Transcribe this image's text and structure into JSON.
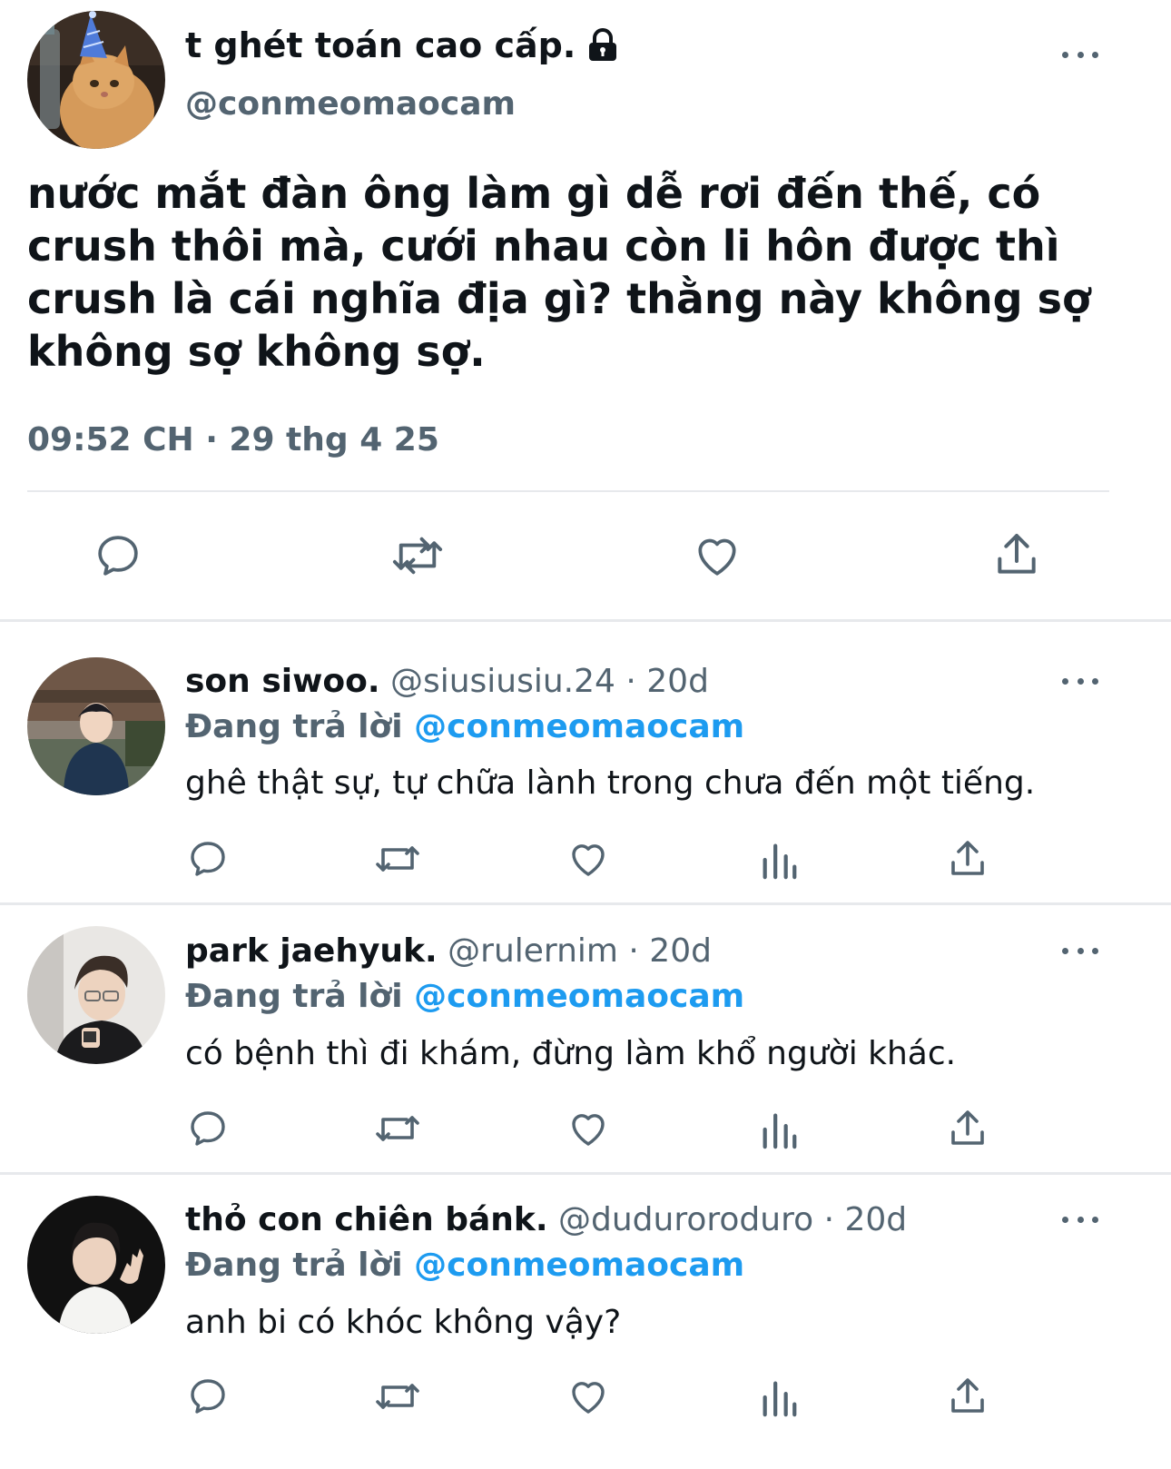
{
  "main_tweet": {
    "display_name": "t ghét toán cao cấp.",
    "handle": "@conmeomaocam",
    "text": "nước mắt đàn ông làm gì dễ rơi đến thế, có crush thôi mà, cưới nhau còn li hôn được thì crush là cái nghĩa địa gì? thằng này không sợ không sợ không sợ.",
    "timestamp": "09:52 CH · 29 thg 4 25",
    "icons": [
      "lock-icon",
      "more-icon",
      "reply-icon",
      "retweet-icon",
      "like-icon",
      "share-icon"
    ]
  },
  "replies": [
    {
      "display_name": "son siwoo.",
      "handle": "@siusiusiu.24",
      "time": "· 20d",
      "replying_label": "Đang trả lời",
      "replying_to": "@conmeomaocam",
      "text": "ghê thật sự, tự chữa lành trong chưa đến một tiếng."
    },
    {
      "display_name": "park jaehyuk.",
      "handle": "@rulernim",
      "time": "· 20d",
      "replying_label": "Đang trả lời",
      "replying_to": "@conmeomaocam",
      "text": "có bệnh thì đi khám, đừng làm khổ người khác."
    },
    {
      "display_name": "thỏ con chiên bánk.",
      "handle": "@duduroroduro",
      "time": "· 20d",
      "replying_label": "Đang trả lời",
      "replying_to": "@conmeomaocam",
      "text": "anh bi có khóc không vậy?"
    }
  ],
  "colors": {
    "text": "#0f1419",
    "muted": "#536471",
    "link": "#1d9bf0",
    "divider": "#e7e9ec"
  }
}
